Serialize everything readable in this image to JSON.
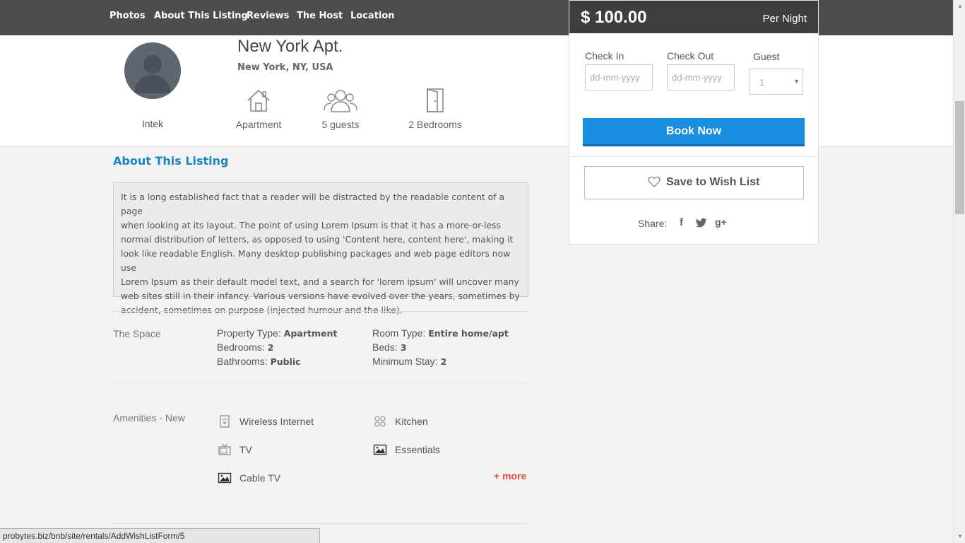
{
  "nav": {
    "items": [
      "Photos",
      "About This Listing",
      "Reviews",
      "The Host",
      "Location"
    ]
  },
  "host": {
    "name": "Intek"
  },
  "listing": {
    "title": "New York Apt.",
    "location": "New York, NY, USA",
    "features": [
      {
        "icon": "house-icon",
        "label": "Apartment"
      },
      {
        "icon": "guests-icon",
        "label": "5 guests"
      },
      {
        "icon": "door-icon",
        "label": "2 Bedrooms"
      }
    ]
  },
  "about": {
    "heading": "About This Listing",
    "description_lines": [
      "It is a long established fact that a reader will be distracted by the readable content of a page",
      "when looking at its layout. The point of using Lorem Ipsum is that it has a more-or-less",
      "normal distribution of letters, as opposed to using 'Content here, content here', making it",
      "look like readable English. Many desktop publishing packages and web page editors now use",
      "Lorem Ipsum as their default model text, and a search for 'lorem ipsum' will uncover many",
      "web sites still in their infancy. Various versions have evolved over the years, sometimes by",
      "accident, sometimes on purpose (injected humour and the like)."
    ]
  },
  "space": {
    "label": "The Space",
    "rows": [
      {
        "key": "Property Type:",
        "value": "Apartment"
      },
      {
        "key": "Room Type:",
        "value": "Entire home/apt"
      },
      {
        "key": "Bedrooms:",
        "value": "2"
      },
      {
        "key": "Beds:",
        "value": "3"
      },
      {
        "key": "Bathrooms:",
        "value": "Public"
      },
      {
        "key": "Minimum Stay:",
        "value": "2"
      }
    ]
  },
  "amenities": {
    "label": "Amenities - New",
    "items": [
      {
        "icon": "wifi-icon",
        "label": "Wireless Internet"
      },
      {
        "icon": "kitchen-icon",
        "label": "Kitchen"
      },
      {
        "icon": "tv-icon",
        "label": "TV"
      },
      {
        "icon": "image-icon",
        "label": "Essentials"
      },
      {
        "icon": "image-icon",
        "label": "Cable TV"
      }
    ],
    "more_label": "+ more"
  },
  "booking": {
    "price": "$ 100.00",
    "per": "Per Night",
    "check_in_label": "Check In",
    "check_in_placeholder": "dd-mm-yyyy",
    "check_out_label": "Check Out",
    "check_out_placeholder": "dd-mm-yyyy",
    "guest_label": "Guest",
    "guest_value": "1",
    "book_label": "Book Now",
    "wishlist_label": "Save to Wish List",
    "share_label": "Share:",
    "share_icons": [
      "facebook-icon",
      "twitter-icon",
      "google-plus-icon"
    ]
  },
  "status_url": "probytes.biz/bnb/site/rentals/AddWishListForm/5",
  "colors": {
    "nav_bg": "#4c4c4c",
    "accent_blue": "#1a8fe0",
    "heading_blue": "#1a84c4",
    "more_red": "#e04a3a"
  }
}
